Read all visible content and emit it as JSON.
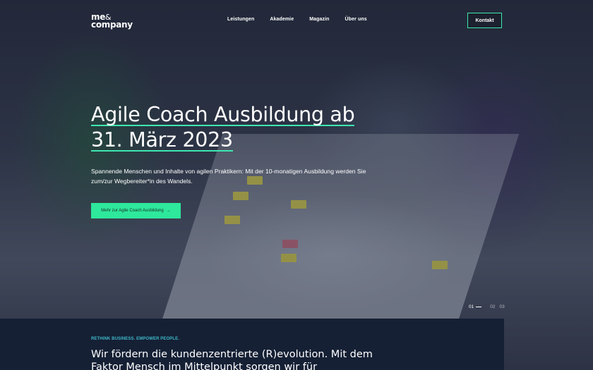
{
  "brand": {
    "logo_line1": "me",
    "logo_amp": "&",
    "logo_line2": "company"
  },
  "nav": {
    "items": [
      {
        "label": "Leistungen"
      },
      {
        "label": "Akademie"
      },
      {
        "label": "Magazin"
      },
      {
        "label": "Über uns"
      }
    ],
    "contact_label": "Kontakt"
  },
  "hero": {
    "headline_line1": "Agile Coach Ausbildung ab",
    "headline_line2": "31. März 2023",
    "lead": "Spannende Menschen und Inhalte von agilen Praktikern: Mit der 10-monatigen Ausbildung werden Sie zum/zur Wegbereiter*in des Wandels.",
    "cta_label": "Mehr zur Agile Coach Ausbildung",
    "cta_arrow": "→"
  },
  "slider": {
    "active": "01",
    "others": [
      "02",
      "03"
    ]
  },
  "panel": {
    "eyebrow": "RETHINK BUSINESS. EMPOWER PEOPLE.",
    "text": "Wir fördern die kundenzentrierte (R)evolution. Mit dem Faktor Mensch im Mittelpunkt sorgen wir für"
  },
  "colors": {
    "accent": "#3ee8b0",
    "cta": "#2ee89c",
    "panel": "#152035",
    "eyebrow": "#3fb7c8"
  }
}
